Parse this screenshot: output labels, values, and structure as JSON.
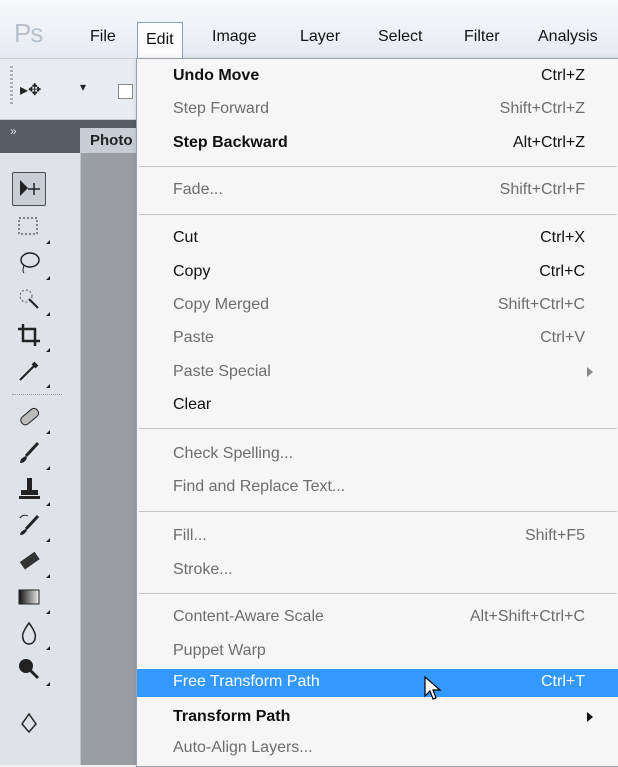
{
  "app": {
    "logo": "Ps"
  },
  "menubar": {
    "items": [
      {
        "label": "File"
      },
      {
        "label": "Edit"
      },
      {
        "label": "Image"
      },
      {
        "label": "Layer"
      },
      {
        "label": "Select"
      },
      {
        "label": "Filter"
      },
      {
        "label": "Analysis"
      }
    ]
  },
  "doc_tab": {
    "label": "Photo"
  },
  "edit_menu": {
    "items": [
      {
        "label": "Undo Move",
        "shortcut": "Ctrl+Z"
      },
      {
        "label": "Step Forward",
        "shortcut": "Shift+Ctrl+Z"
      },
      {
        "label": "Step Backward",
        "shortcut": "Alt+Ctrl+Z"
      },
      {
        "label": "Fade...",
        "shortcut": "Shift+Ctrl+F"
      },
      {
        "label": "Cut",
        "shortcut": "Ctrl+X"
      },
      {
        "label": "Copy",
        "shortcut": "Ctrl+C"
      },
      {
        "label": "Copy Merged",
        "shortcut": "Shift+Ctrl+C"
      },
      {
        "label": "Paste",
        "shortcut": "Ctrl+V"
      },
      {
        "label": "Paste Special",
        "shortcut": ""
      },
      {
        "label": "Clear",
        "shortcut": ""
      },
      {
        "label": "Check Spelling...",
        "shortcut": ""
      },
      {
        "label": "Find and Replace Text...",
        "shortcut": ""
      },
      {
        "label": "Fill...",
        "shortcut": "Shift+F5"
      },
      {
        "label": "Stroke...",
        "shortcut": ""
      },
      {
        "label": "Content-Aware Scale",
        "shortcut": "Alt+Shift+Ctrl+C"
      },
      {
        "label": "Puppet Warp",
        "shortcut": ""
      },
      {
        "label": "Free Transform Path",
        "shortcut": "Ctrl+T"
      },
      {
        "label": "Transform Path",
        "shortcut": ""
      },
      {
        "label": "Auto-Align Layers...",
        "shortcut": ""
      }
    ]
  },
  "tools": [
    "move-tool-icon",
    "marquee-tool-icon",
    "lasso-tool-icon",
    "quick-selection-tool-icon",
    "crop-tool-icon",
    "eyedropper-tool-icon",
    "healing-brush-tool-icon",
    "brush-tool-icon",
    "clone-stamp-tool-icon",
    "history-brush-tool-icon",
    "eraser-tool-icon",
    "gradient-tool-icon",
    "blur-tool-icon",
    "dodge-tool-icon",
    "pen-tool-icon"
  ],
  "colors": {
    "highlight": "#3399ff",
    "disabled_text": "#6d6d6d"
  }
}
